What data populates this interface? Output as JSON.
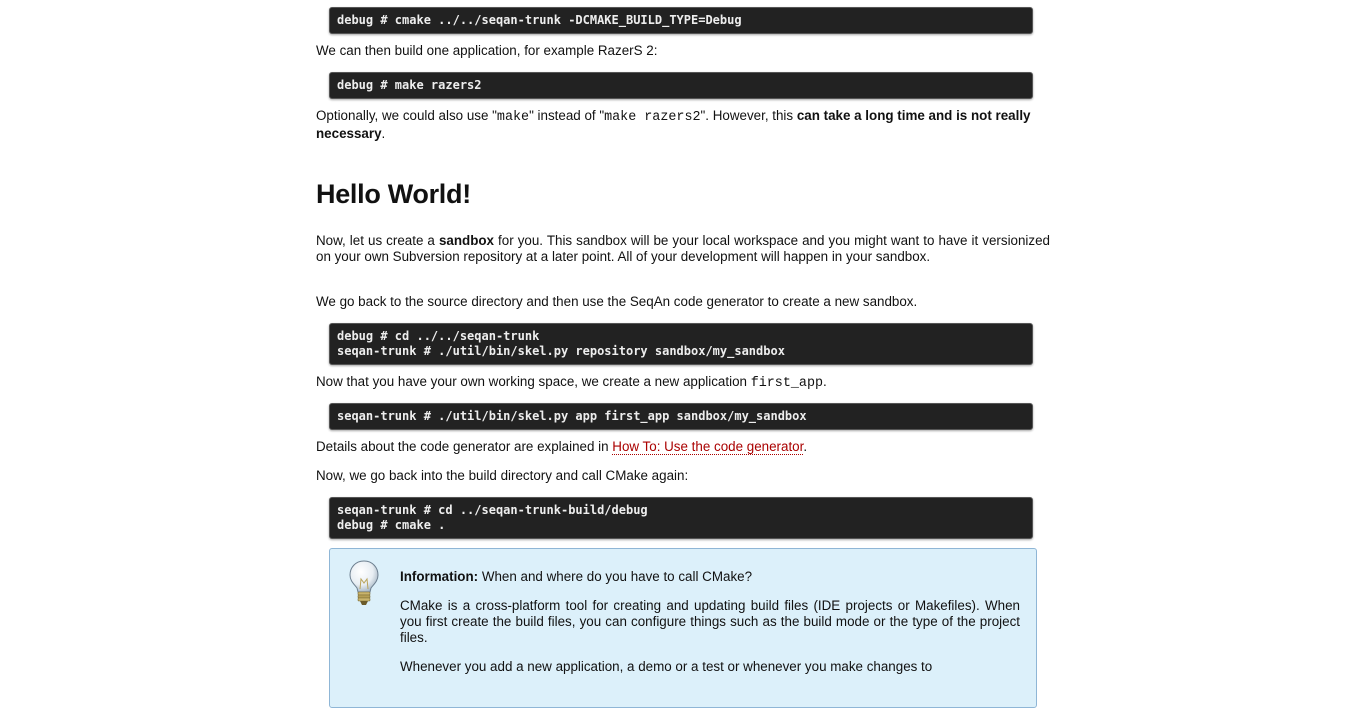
{
  "code_blocks": {
    "cmake_debug": "debug # cmake ../../seqan-trunk -DCMAKE_BUILD_TYPE=Debug",
    "make_razers2": "debug # make razers2",
    "cd_and_skel": "debug # cd ../../seqan-trunk\nseqan-trunk # ./util/bin/skel.py repository sandbox/my_sandbox",
    "skel_app": "seqan-trunk # ./util/bin/skel.py app first_app sandbox/my_sandbox",
    "cd_build_cmake": "seqan-trunk # cd ../seqan-trunk-build/debug\ndebug # cmake ."
  },
  "paragraphs": {
    "build_one": "We can then build one application, for example RazerS 2:",
    "optionally": {
      "t1": "Optionally, we could also use \"",
      "c1": "make",
      "t2": "\" instead of \"",
      "c2": "make razers2",
      "t3": "\". However, this ",
      "bold": "can take a long time and is not really necessary",
      "t4": "."
    },
    "sandbox": {
      "t1": "Now, let us create a ",
      "bold": "sandbox",
      "t2": " for you. This sandbox will be your local workspace and you might want to have it versionized on your own Subversion repository at a later point. All of your development will happen in your sandbox."
    },
    "go_back": "We go back to the source directory and then use the SeqAn code generator to create a new sandbox.",
    "working_space": {
      "t1": "Now that you have your own working space, we create a new application ",
      "code": "first_app",
      "t2": "."
    },
    "details": {
      "t1": "Details about the code generator are explained in ",
      "link": "How To: Use the code generator",
      "t2": "."
    },
    "build_dir": "Now, we go back into the build directory and call CMake again:"
  },
  "heading": "Hello World!",
  "info_box": {
    "icon": "lightbulb-icon",
    "title": "Information:",
    "question": " When and where do you have to call CMake?",
    "p1": "CMake is a cross-platform tool for creating and updating build files (IDE projects or Makefiles). When you first create the build files, you can configure things such as the build mode or the type of the project files.",
    "p2": "Whenever you add a new application, a demo or a test or whenever you make changes to"
  },
  "colors": {
    "code_bg": "#222222",
    "link": "#aa0000",
    "info_bg": "#dcf0fa",
    "info_border": "#8fb6d6"
  }
}
